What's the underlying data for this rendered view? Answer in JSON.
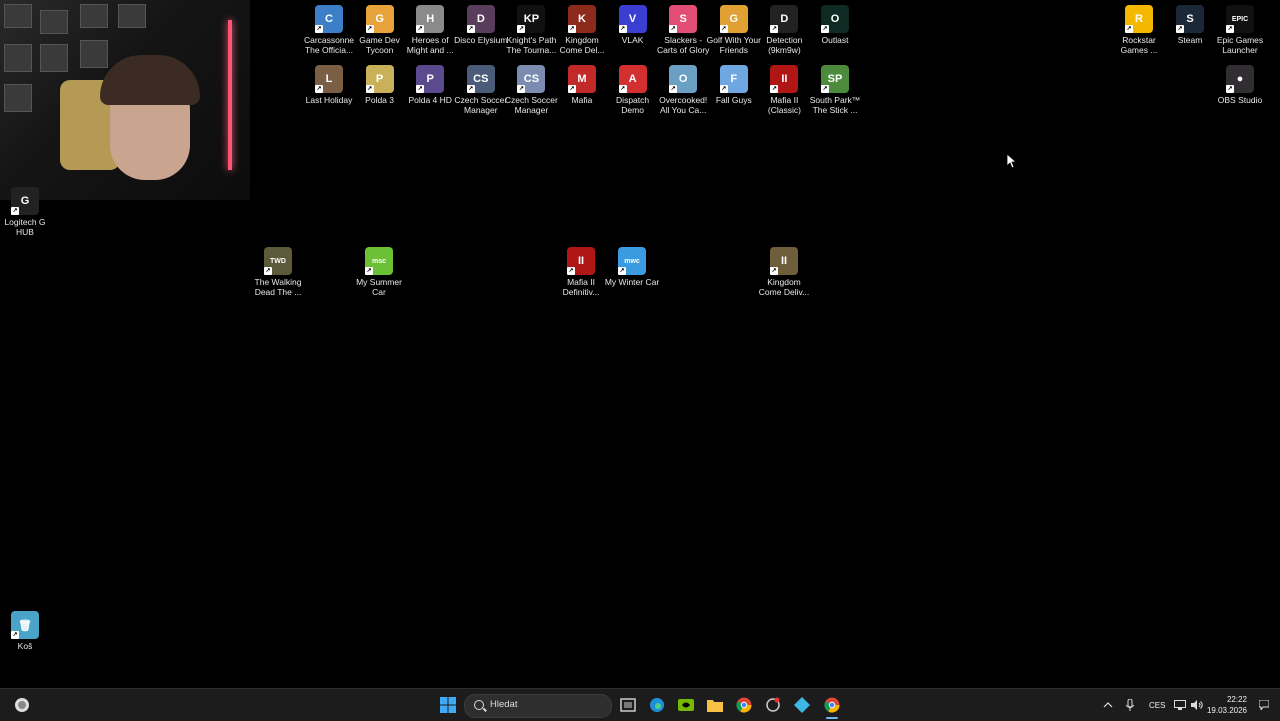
{
  "desktop": {
    "row1": [
      {
        "label": "Carcassonne The Officia...",
        "color": "#3c7ec7",
        "glyph": "C"
      },
      {
        "label": "Game Dev Tycoon",
        "color": "#e8a23a",
        "glyph": "G"
      },
      {
        "label": "Heroes of Might and ...",
        "color": "#8a8a8a",
        "glyph": "H"
      },
      {
        "label": "Disco Elysium",
        "color": "#5a3d5c",
        "glyph": "D"
      },
      {
        "label": "Knight's Path The Tourna...",
        "color": "#111111",
        "glyph": "KP"
      },
      {
        "label": "Kingdom Come Del...",
        "color": "#8c2a1c",
        "glyph": "K"
      },
      {
        "label": "VLAK",
        "color": "#3b3fd1",
        "glyph": "V"
      },
      {
        "label": "Slackers - Carts of Glory",
        "color": "#e24d74",
        "glyph": "S"
      },
      {
        "label": "Golf With Your Friends",
        "color": "#e0a034",
        "glyph": "G"
      },
      {
        "label": "Detection (9km9w)",
        "color": "#222222",
        "glyph": "D"
      },
      {
        "label": "Outlast",
        "color": "#0f2a22",
        "glyph": "O"
      }
    ],
    "row2": [
      {
        "label": "Last Holiday",
        "color": "#7a5f45",
        "glyph": "L"
      },
      {
        "label": "Polda 3",
        "color": "#c9b15a",
        "glyph": "P"
      },
      {
        "label": "Polda 4 HD",
        "color": "#5c4a8e",
        "glyph": "P"
      },
      {
        "label": "Czech Soccer Manager",
        "color": "#4a5c7a",
        "glyph": "CS"
      },
      {
        "label": "Czech Soccer Manager",
        "color": "#7c8bb0",
        "glyph": "CS"
      },
      {
        "label": "Mafia",
        "color": "#c22a2a",
        "glyph": "M"
      },
      {
        "label": "Dispatch Demo",
        "color": "#d23030",
        "glyph": "A"
      },
      {
        "label": "Overcooked! All You Ca...",
        "color": "#6aa0c4",
        "glyph": "O"
      },
      {
        "label": "Fall Guys",
        "color": "#6fa8e0",
        "glyph": "F"
      },
      {
        "label": "Mafia II (Classic)",
        "color": "#b01616",
        "glyph": "II"
      },
      {
        "label": "South Park™ The Stick ...",
        "color": "#4d8b3c",
        "glyph": "SP"
      }
    ],
    "row3": [
      {
        "label": "The Walking Dead The ...",
        "color": "#5d5a3a",
        "glyph": "TWD"
      },
      {
        "label": "My Summer Car",
        "color": "#6cc036",
        "glyph": "msc"
      },
      {
        "label": "Mafia II Definitiv...",
        "color": "#b01616",
        "glyph": "II"
      },
      {
        "label": "My Winter Car",
        "color": "#3a9be0",
        "glyph": "mwc"
      },
      {
        "label": "Kingdom Come Deliv...",
        "color": "#6f5e3c",
        "glyph": "II"
      }
    ],
    "right": [
      {
        "label": "Rockstar Games ...",
        "color": "#f5b800",
        "glyph": "R"
      },
      {
        "label": "Steam",
        "color": "#1b2838",
        "glyph": "S"
      },
      {
        "label": "Epic Games Launcher",
        "color": "#111111",
        "glyph": "EPIC"
      },
      {
        "label": "OBS Studio",
        "color": "#302e31",
        "glyph": "●"
      }
    ],
    "left": [
      {
        "label": "Logitech G HUB",
        "color": "#222222",
        "glyph": "G"
      },
      {
        "label": "Koš",
        "color": "#4aa3c8",
        "glyph": "🗑"
      }
    ]
  },
  "taskbar": {
    "search_placeholder": "Hledat",
    "language": "CES",
    "time": "22:22",
    "date": "19.03.2026"
  }
}
